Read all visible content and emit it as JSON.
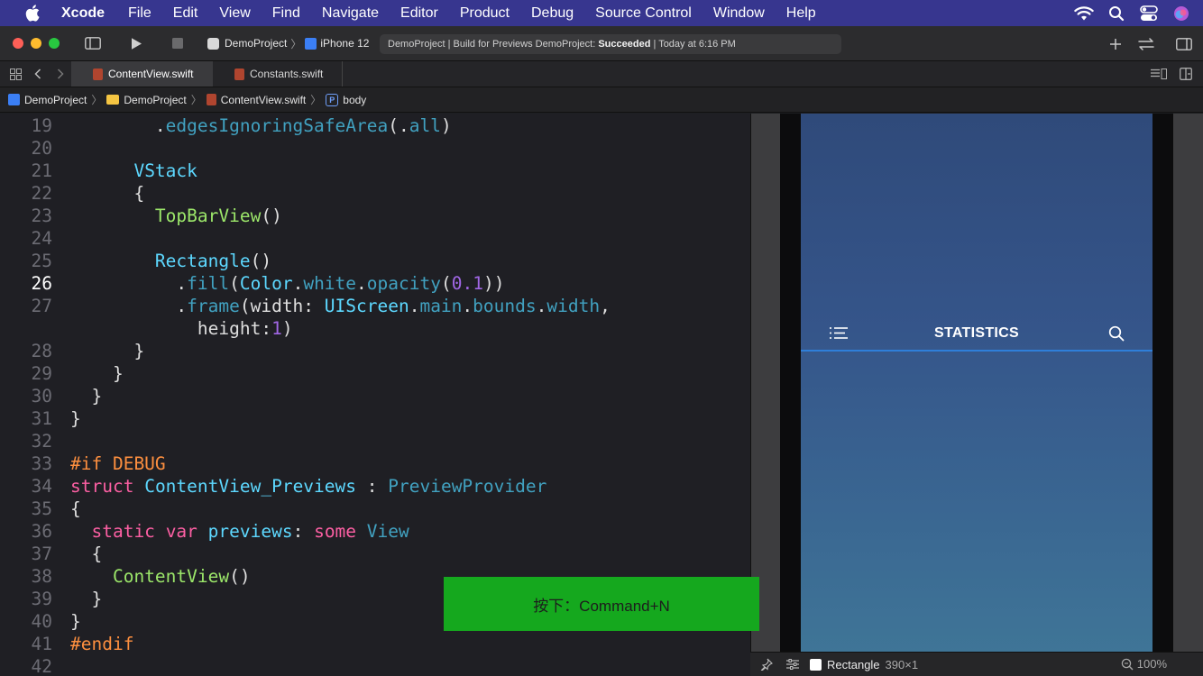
{
  "menubar": {
    "app_name": "Xcode",
    "items": [
      "File",
      "Edit",
      "View",
      "Find",
      "Navigate",
      "Editor",
      "Product",
      "Debug",
      "Source Control",
      "Window",
      "Help"
    ],
    "status_icons": [
      "wifi-icon",
      "spotlight-icon",
      "control-center-icon",
      "siri-icon"
    ]
  },
  "toolbar": {
    "scheme": "DemoProject",
    "device": "iPhone 12",
    "activity_prefix": "DemoProject | Build for Previews DemoProject: ",
    "activity_status": "Succeeded",
    "activity_suffix": " | Today at 6:16 PM"
  },
  "tabs": [
    {
      "label": "ContentView.swift",
      "active": true
    },
    {
      "label": "Constants.swift",
      "active": false
    }
  ],
  "jumpbar": {
    "crumbs": [
      "DemoProject",
      "DemoProject",
      "ContentView.swift",
      "body"
    ],
    "separator": "〉",
    "prop_badge": "P"
  },
  "editor": {
    "current_line": "26",
    "lines": [
      {
        "num": "19",
        "indent": "        ",
        "tokens": [
          {
            "t": ".",
            "c": "pl"
          },
          {
            "t": "edgesIgnoringSafeArea",
            "c": "ot"
          },
          {
            "t": "(.",
            "c": "pl"
          },
          {
            "t": "all",
            "c": "ot"
          },
          {
            "t": ")",
            "c": "pl"
          }
        ]
      },
      {
        "num": "20",
        "indent": "",
        "tokens": []
      },
      {
        "num": "21",
        "indent": "      ",
        "tokens": [
          {
            "t": "VStack",
            "c": "ty"
          }
        ]
      },
      {
        "num": "22",
        "indent": "      ",
        "tokens": [
          {
            "t": "{",
            "c": "pl"
          }
        ]
      },
      {
        "num": "23",
        "indent": "        ",
        "tokens": [
          {
            "t": "TopBarView",
            "c": "tt"
          },
          {
            "t": "()",
            "c": "pl"
          }
        ]
      },
      {
        "num": "24",
        "indent": "",
        "tokens": []
      },
      {
        "num": "25",
        "indent": "        ",
        "tokens": [
          {
            "t": "Rectangle",
            "c": "ty"
          },
          {
            "t": "()",
            "c": "pl"
          }
        ]
      },
      {
        "num": "26",
        "indent": "          ",
        "tokens": [
          {
            "t": ".",
            "c": "pl"
          },
          {
            "t": "fill",
            "c": "ot"
          },
          {
            "t": "(",
            "c": "pl"
          },
          {
            "t": "Color",
            "c": "ty"
          },
          {
            "t": ".",
            "c": "pl"
          },
          {
            "t": "white",
            "c": "ot"
          },
          {
            "t": ".",
            "c": "pl"
          },
          {
            "t": "opacity",
            "c": "ot"
          },
          {
            "t": "(",
            "c": "pl"
          },
          {
            "t": "0.1",
            "c": "us"
          },
          {
            "t": "))",
            "c": "pl"
          }
        ]
      },
      {
        "num": "27",
        "indent": "          ",
        "tokens": [
          {
            "t": ".",
            "c": "pl"
          },
          {
            "t": "frame",
            "c": "ot"
          },
          {
            "t": "(width: ",
            "c": "pl"
          },
          {
            "t": "UIScreen",
            "c": "ty"
          },
          {
            "t": ".",
            "c": "pl"
          },
          {
            "t": "main",
            "c": "ot"
          },
          {
            "t": ".",
            "c": "pl"
          },
          {
            "t": "bounds",
            "c": "ot"
          },
          {
            "t": ".",
            "c": "pl"
          },
          {
            "t": "width",
            "c": "ot"
          },
          {
            "t": ",",
            "c": "pl"
          }
        ]
      },
      {
        "num": "",
        "indent": "            ",
        "tokens": [
          {
            "t": "height:",
            "c": "pl"
          },
          {
            "t": "1",
            "c": "us"
          },
          {
            "t": ")",
            "c": "pl"
          }
        ]
      },
      {
        "num": "28",
        "indent": "      ",
        "tokens": [
          {
            "t": "}",
            "c": "pl"
          }
        ]
      },
      {
        "num": "29",
        "indent": "    ",
        "tokens": [
          {
            "t": "}",
            "c": "pl"
          }
        ]
      },
      {
        "num": "30",
        "indent": "  ",
        "tokens": [
          {
            "t": "}",
            "c": "pl"
          }
        ]
      },
      {
        "num": "31",
        "indent": "",
        "tokens": [
          {
            "t": "}",
            "c": "pl"
          }
        ]
      },
      {
        "num": "32",
        "indent": "",
        "tokens": []
      },
      {
        "num": "33",
        "indent": "",
        "tokens": [
          {
            "t": "#if DEBUG",
            "c": "pp"
          }
        ]
      },
      {
        "num": "34",
        "indent": "",
        "tokens": [
          {
            "t": "struct",
            "c": "kw"
          },
          {
            "t": " ",
            "c": "pl"
          },
          {
            "t": "ContentView_Previews",
            "c": "ty"
          },
          {
            "t": " : ",
            "c": "pl"
          },
          {
            "t": "PreviewProvider",
            "c": "ot"
          }
        ]
      },
      {
        "num": "35",
        "indent": "",
        "tokens": [
          {
            "t": "{",
            "c": "pl"
          }
        ]
      },
      {
        "num": "36",
        "indent": "  ",
        "tokens": [
          {
            "t": "static",
            "c": "kw"
          },
          {
            "t": " ",
            "c": "pl"
          },
          {
            "t": "var",
            "c": "kw"
          },
          {
            "t": " ",
            "c": "pl"
          },
          {
            "t": "previews",
            "c": "ty"
          },
          {
            "t": ": ",
            "c": "pl"
          },
          {
            "t": "some",
            "c": "kw"
          },
          {
            "t": " ",
            "c": "pl"
          },
          {
            "t": "View",
            "c": "ot"
          }
        ]
      },
      {
        "num": "37",
        "indent": "  ",
        "tokens": [
          {
            "t": "{",
            "c": "pl"
          }
        ]
      },
      {
        "num": "38",
        "indent": "    ",
        "tokens": [
          {
            "t": "ContentView",
            "c": "tt"
          },
          {
            "t": "()",
            "c": "pl"
          }
        ]
      },
      {
        "num": "39",
        "indent": "  ",
        "tokens": [
          {
            "t": "}",
            "c": "pl"
          }
        ]
      },
      {
        "num": "40",
        "indent": "",
        "tokens": [
          {
            "t": "}",
            "c": "pl"
          }
        ]
      },
      {
        "num": "41",
        "indent": "",
        "tokens": [
          {
            "t": "#endif",
            "c": "pp"
          }
        ]
      },
      {
        "num": "42",
        "indent": "",
        "tokens": []
      }
    ]
  },
  "key_hint": "按下：Command+N",
  "preview": {
    "title": "STATISTICS",
    "left_icon": "menu-lines-icon",
    "right_icon": "search-icon"
  },
  "canvas_bar": {
    "element": "Rectangle",
    "dimensions": "390×1",
    "zoom": "100%"
  },
  "colors": {
    "menubar": "#37368f",
    "accent_blue": "#2f7fd9",
    "key_hint_bg": "#15a81e"
  }
}
